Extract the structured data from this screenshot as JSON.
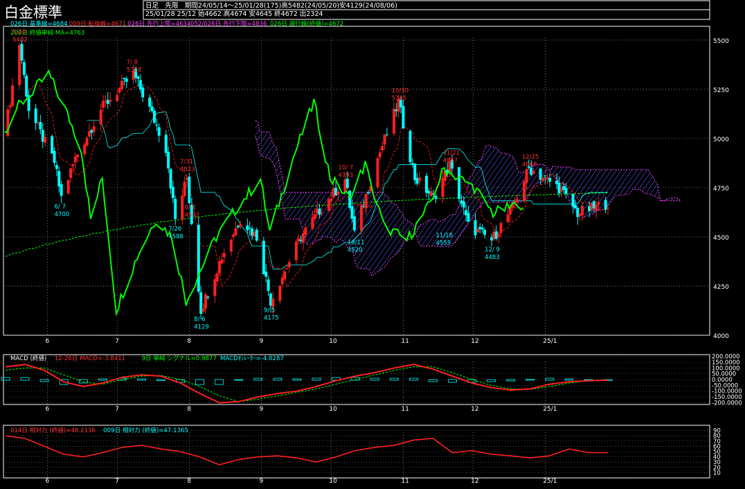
{
  "header": {
    "title": "白金標準",
    "line1": "日足　先限　期間24/05/14～25/01/28(175)高5482(24/05/20)安4129(24/08/06)",
    "line2": "25/01/28 25/12 始4662 高4674 安4645 終4672 出2324"
  },
  "legend_main": [
    {
      "text": "026日 基準線=4684",
      "color": "#00ffff"
    },
    {
      "text": "009日 転換線=4671",
      "color": "#ff3030"
    },
    {
      "text": "026日 先行上限=4634",
      "color": "#ff40ff"
    },
    {
      "text": "052/026日 先行下限=4836",
      "color": "#ff40ff"
    },
    {
      "text": "026日 遅行線(終値)=4672",
      "color": "#00ff00"
    }
  ],
  "legend_main2": {
    "text": "200日 終値単純 MA=4763",
    "color": "#00ff00"
  },
  "legend_macd": [
    {
      "text": "MACD (終値)",
      "color": "#ffffff"
    },
    {
      "text": "12-26日 MACD=-3.8411",
      "color": "#ff3030"
    },
    {
      "text": "9日 単純 シグナル=0.9877",
      "color": "#00ff00"
    },
    {
      "text": "MACDｵｼﾚｰﾀｰ=-4.8287",
      "color": "#00ffff"
    }
  ],
  "legend_rsi": [
    {
      "text": "014日 相対力 (終値)=48.2136",
      "color": "#ff3030"
    },
    {
      "text": "009日 相対力 (終値)=47.1365",
      "color": "#00ffff"
    }
  ],
  "colors": {
    "background": "#000000",
    "frame": "#ffffff",
    "up": "#ff2020",
    "down": "#00ffff",
    "kijun": "#00ffff",
    "tenkan": "#ff2020",
    "cloud": "#ff40ff",
    "chikou": "#00ff00",
    "ma": "#00ff00"
  },
  "chart_data": [
    {
      "type": "candlestick",
      "title": "白金標準",
      "x_month_labels": [
        "6",
        "7",
        "8",
        "9",
        "10",
        "11",
        "12",
        "25/1"
      ],
      "y_ticks": [
        4000,
        4250,
        4500,
        4750,
        5000,
        5250,
        5500
      ],
      "ylim": [
        4000,
        5570
      ],
      "grid": true,
      "ohlc_close_path": [
        {
          "date": "24/05/14",
          "close": 5050
        },
        {
          "date": "24/05/20",
          "close": 5482
        },
        {
          "date": "24/05/24",
          "close": 5150
        },
        {
          "date": "24/06/04",
          "close": 4880
        },
        {
          "date": "24/06/07",
          "close": 4700
        },
        {
          "date": "24/06/13",
          "close": 4900
        },
        {
          "date": "24/06/24",
          "close": 5150
        },
        {
          "date": "24/07/08",
          "close": 5328
        },
        {
          "date": "24/07/15",
          "close": 5150
        },
        {
          "date": "24/07/22",
          "close": 4950
        },
        {
          "date": "24/07/26",
          "close": 4588
        },
        {
          "date": "24/07/31",
          "close": 4800
        },
        {
          "date": "24/08/06",
          "close": 4129
        },
        {
          "date": "24/08/15",
          "close": 4400
        },
        {
          "date": "24/08/23",
          "close": 4592
        },
        {
          "date": "24/08/30",
          "close": 4500
        },
        {
          "date": "24/09/05",
          "close": 4175
        },
        {
          "date": "24/09/18",
          "close": 4500
        },
        {
          "date": "24/09/27",
          "close": 4650
        },
        {
          "date": "24/10/07",
          "close": 4793
        },
        {
          "date": "24/10/11",
          "close": 4520
        },
        {
          "date": "24/10/21",
          "close": 4900
        },
        {
          "date": "24/10/30",
          "close": 5185
        },
        {
          "date": "24/11/06",
          "close": 4800
        },
        {
          "date": "24/11/14",
          "close": 4700
        },
        {
          "date": "24/11/21",
          "close": 4867
        },
        {
          "date": "24/11/29",
          "close": 4555
        },
        {
          "date": "24/12/09",
          "close": 4483
        },
        {
          "date": "24/12/18",
          "close": 4650
        },
        {
          "date": "24/12/25",
          "close": 4848
        },
        {
          "date": "25/01/07",
          "close": 4750
        },
        {
          "date": "25/01/15",
          "close": 4620
        },
        {
          "date": "25/01/28",
          "close": 4672
        }
      ],
      "annotations": [
        {
          "date": "5/20",
          "value": "5482",
          "color": "#ff3030"
        },
        {
          "date": "7/ 8",
          "value": "5328",
          "color": "#ff3030"
        },
        {
          "date": "7/31",
          "value": "4823",
          "color": "#ff3030"
        },
        {
          "date": "8/ 2",
          "value": "4592",
          "color": "#ff3030"
        },
        {
          "date": "10/ 7",
          "value": "4793",
          "color": "#ff3030"
        },
        {
          "date": "10/30",
          "value": "5185",
          "color": "#ff3030"
        },
        {
          "date": "11/21",
          "value": "4867",
          "color": "#ff3030"
        },
        {
          "date": "12/25",
          "value": "4848",
          "color": "#ff3030"
        },
        {
          "date": "6/ 7",
          "value": "4700",
          "color": "#00ffff"
        },
        {
          "date": "7/26",
          "value": "4588",
          "color": "#00ffff"
        },
        {
          "date": "8/ 6",
          "value": "4129",
          "color": "#00ffff"
        },
        {
          "date": "9/ 5",
          "value": "4175",
          "color": "#00ffff"
        },
        {
          "date": "10/11",
          "value": "4520",
          "color": "#00ffff"
        },
        {
          "date": "11/18",
          "value": "4555",
          "color": "#00ffff"
        },
        {
          "date": "12/ 9",
          "value": "4483",
          "color": "#00ffff"
        }
      ]
    },
    {
      "type": "line",
      "title": "MACD (終値)",
      "y_ticks": [
        200,
        150,
        100,
        50,
        0,
        -50,
        -100,
        -150,
        -200
      ],
      "y_tick_labels": [
        "200.0000",
        "150.0000",
        "100.0000",
        "50.0000",
        "0.0000",
        "-50.0000",
        "-100.0000",
        "-150.0000",
        "-200.0000"
      ],
      "ylim": [
        -215,
        215
      ],
      "series": [
        {
          "name": "12-26日 MACD",
          "values": [
            110,
            130,
            80,
            -20,
            -60,
            -30,
            20,
            40,
            30,
            -30,
            -120,
            -200,
            -190,
            -150,
            -120,
            -100,
            -60,
            -10,
            30,
            60,
            100,
            130,
            90,
            30,
            -30,
            -70,
            -90,
            -80,
            -40,
            -20,
            -10,
            -4
          ]
        },
        {
          "name": "9日 単純 シグナル",
          "values": [
            80,
            100,
            100,
            40,
            -20,
            -40,
            0,
            30,
            35,
            0,
            -60,
            -140,
            -190,
            -170,
            -140,
            -110,
            -80,
            -40,
            0,
            40,
            80,
            110,
            110,
            60,
            0,
            -50,
            -80,
            -85,
            -60,
            -30,
            -10,
            1
          ]
        }
      ]
    },
    {
      "type": "line",
      "title": "相対力 (終値)",
      "y_ticks": [
        90,
        80,
        70,
        60,
        50,
        40,
        30,
        20,
        10
      ],
      "ylim": [
        0,
        100
      ],
      "series": [
        {
          "name": "014日 相対力",
          "values": [
            80,
            75,
            60,
            45,
            40,
            48,
            58,
            62,
            55,
            50,
            40,
            25,
            35,
            40,
            42,
            38,
            30,
            40,
            52,
            58,
            62,
            72,
            75,
            48,
            52,
            45,
            42,
            38,
            42,
            55,
            48,
            48
          ]
        }
      ]
    }
  ]
}
